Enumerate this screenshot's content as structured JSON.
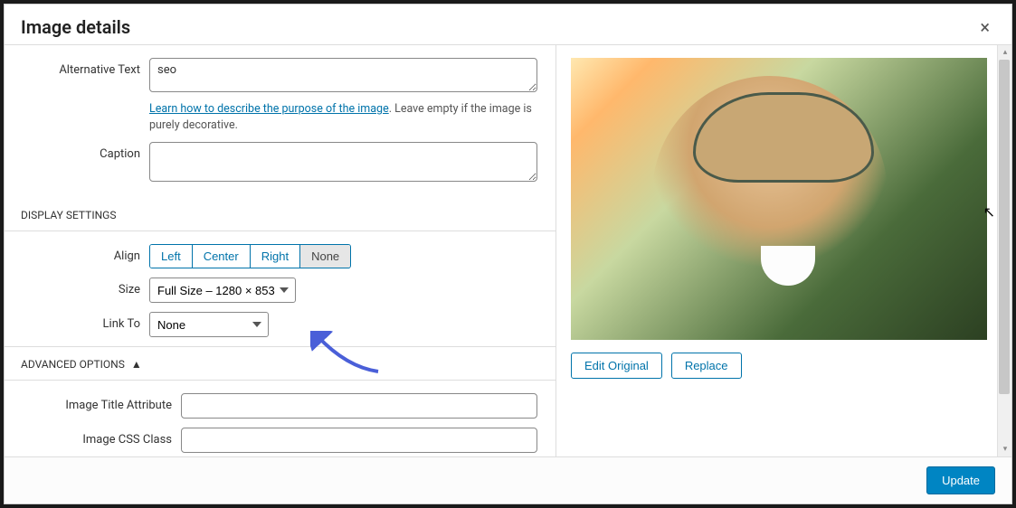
{
  "modal": {
    "title": "Image details",
    "close_label": "×"
  },
  "fields": {
    "alt_text": {
      "label": "Alternative Text",
      "value": "seo"
    },
    "alt_help_link": "Learn how to describe the purpose of the image",
    "alt_help_suffix": ". Leave empty if the image is purely decorative.",
    "caption": {
      "label": "Caption",
      "value": ""
    }
  },
  "display_settings": {
    "header": "DISPLAY SETTINGS",
    "align": {
      "label": "Align",
      "options": [
        "Left",
        "Center",
        "Right",
        "None"
      ],
      "active": "None"
    },
    "size": {
      "label": "Size",
      "value": "Full Size – 1280 × 853"
    },
    "link_to": {
      "label": "Link To",
      "value": "None"
    }
  },
  "advanced": {
    "header": "ADVANCED OPTIONS",
    "caret": "▲",
    "title_attr": {
      "label": "Image Title Attribute",
      "value": ""
    },
    "css_class": {
      "label": "Image CSS Class",
      "value": ""
    }
  },
  "preview": {
    "edit_original": "Edit Original",
    "replace": "Replace"
  },
  "footer": {
    "update": "Update"
  }
}
